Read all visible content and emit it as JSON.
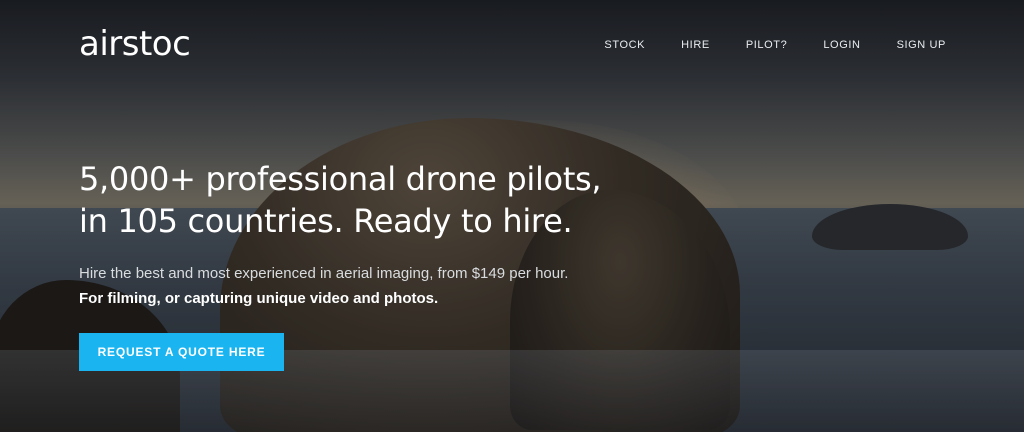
{
  "brand": {
    "logo_text": "airstoc"
  },
  "nav": {
    "items": [
      {
        "label": "STOCK"
      },
      {
        "label": "HIRE"
      },
      {
        "label": "PILOT?"
      },
      {
        "label": "LOGIN"
      },
      {
        "label": "SIGN UP"
      }
    ]
  },
  "hero": {
    "headline_line1": "5,000+ professional drone pilots,",
    "headline_line2": "in 105 countries. Ready to hire.",
    "subtext": "Hire the best and most experienced in aerial imaging, from $149 per hour.",
    "subtext_strong": "For filming, or capturing unique video and photos.",
    "cta_label": "REQUEST A QUOTE HERE"
  },
  "colors": {
    "accent": "#1ab5f0",
    "text": "#ffffff"
  }
}
